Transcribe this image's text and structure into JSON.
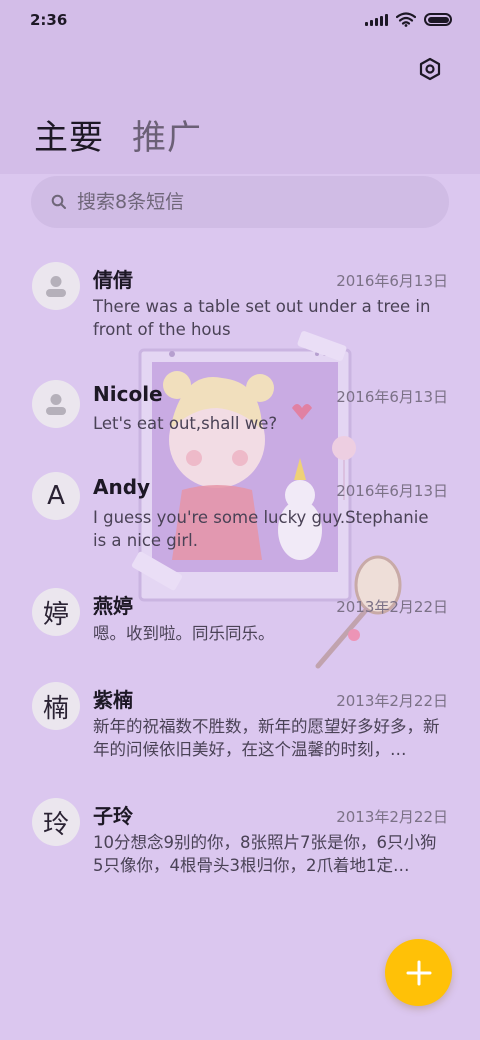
{
  "status": {
    "time": "2:36"
  },
  "header": {
    "tab_primary": "主要",
    "tab_promotions": "推广",
    "settings_icon": "gear-hexagon-icon"
  },
  "search": {
    "placeholder": "搜索8条短信"
  },
  "messages": [
    {
      "avatar": "person-icon",
      "name": "倩倩",
      "date": "2016年6月13日",
      "preview": "There was a table set out under a tree in front of the hous"
    },
    {
      "avatar": "person-icon",
      "name": "Nicole",
      "date": "2016年6月13日",
      "preview": "Let's eat out,shall we?"
    },
    {
      "avatar": "A",
      "name": "Andy",
      "date": "2016年6月13日",
      "preview": "I guess you're some lucky guy.Stephanie is a nice girl."
    },
    {
      "avatar": "婷",
      "name": "燕婷",
      "date": "2013年2月22日",
      "preview": "嗯。收到啦。同乐同乐。"
    },
    {
      "avatar": "楠",
      "name": "紫楠",
      "date": "2013年2月22日",
      "preview": "新年的祝福数不胜数，新年的愿望好多好多，新年的问候依旧美好，在这个温馨的时刻，…"
    },
    {
      "avatar": "玲",
      "name": "子玲",
      "date": "2013年2月22日",
      "preview": "10分想念9别的你，8张照片7张是你，6只小狗5只像你，4根骨头3根归你，2爪着地1定…"
    }
  ],
  "fab": {
    "icon": "plus-icon"
  },
  "colors": {
    "background": "#dbc7ef",
    "fab": "#ffc107",
    "accent_text": "#1d1825"
  }
}
